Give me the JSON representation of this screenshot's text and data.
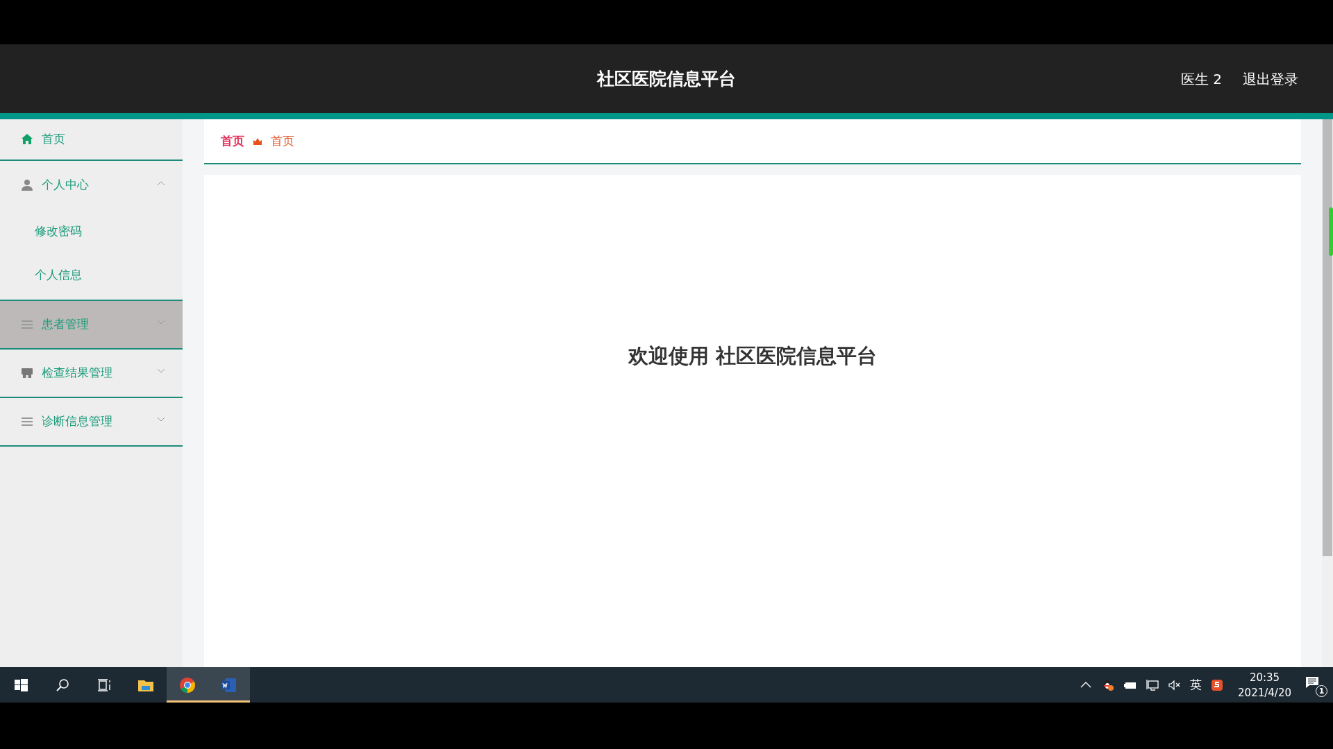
{
  "header": {
    "title": "社区医院信息平台",
    "user": "医生 2",
    "logout": "退出登录"
  },
  "sidebar": {
    "items": [
      {
        "label": "首页",
        "kind": "home",
        "highlighted": false
      },
      {
        "label": "个人中心",
        "kind": "user",
        "highlighted": false,
        "expanded": true,
        "children": [
          {
            "label": "修改密码"
          },
          {
            "label": "个人信息"
          }
        ]
      },
      {
        "label": "患者管理",
        "kind": "list",
        "highlighted": true,
        "expanded": false
      },
      {
        "label": "检查结果管理",
        "kind": "store",
        "highlighted": false,
        "expanded": false
      },
      {
        "label": "诊断信息管理",
        "kind": "list",
        "highlighted": false,
        "expanded": false
      }
    ]
  },
  "breadcrumb": [
    "首页",
    "首页"
  ],
  "welcome": "欢迎使用 社区医院信息平台",
  "taskbar": {
    "apps": [
      {
        "kind": "start",
        "active": false
      },
      {
        "kind": "search",
        "active": false
      },
      {
        "kind": "taskview",
        "active": false
      },
      {
        "kind": "explorer",
        "active": false
      },
      {
        "kind": "chrome",
        "active": true
      },
      {
        "kind": "word",
        "active": true
      }
    ],
    "language": "英",
    "time": "20:35",
    "date": "2021/4/20",
    "notifications": "1"
  }
}
